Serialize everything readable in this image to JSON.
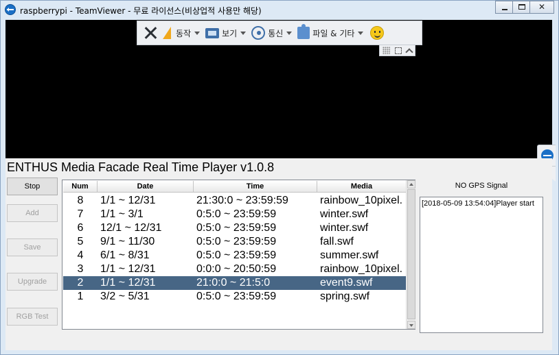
{
  "window": {
    "title": "raspberrypi - TeamViewer - 무료 라이선스(비상업적 사용만 해당)",
    "controls": {
      "minimize": "—",
      "maximize": "□",
      "close": "✕"
    }
  },
  "teamviewer_toolbar": {
    "items": [
      {
        "label": "동작",
        "icon": "bolt-icon"
      },
      {
        "label": "보기",
        "icon": "monitor-icon"
      },
      {
        "label": "통신",
        "icon": "phone-icon"
      },
      {
        "label": "파일 & 기타",
        "icon": "puzzle-icon"
      }
    ],
    "icons": [
      "close-icon",
      "smiley-icon",
      "grip-icon",
      "fullscreen-icon",
      "collapse-icon"
    ]
  },
  "app": {
    "title": "ENTHUS Media Facade Real Time Player v1.0.8",
    "buttons": [
      {
        "label": "Stop",
        "enabled": true
      },
      {
        "label": "Add",
        "enabled": false
      },
      {
        "label": "Save",
        "enabled": false
      },
      {
        "label": "Upgrade",
        "enabled": false
      },
      {
        "label": "RGB Test",
        "enabled": false
      }
    ],
    "table": {
      "columns": [
        "Num",
        "Date",
        "Time",
        "Media"
      ],
      "rows": [
        {
          "num": "8",
          "date": "1/1 ~ 12/31",
          "time": "21:30:0 ~ 23:59:59",
          "media": "rainbow_10pixel."
        },
        {
          "num": "7",
          "date": "1/1 ~ 3/1",
          "time": "0:5:0 ~ 23:59:59",
          "media": "winter.swf"
        },
        {
          "num": "6",
          "date": "12/1 ~ 12/31",
          "time": "0:5:0 ~ 23:59:59",
          "media": "winter.swf"
        },
        {
          "num": "5",
          "date": "9/1 ~ 11/30",
          "time": "0:5:0 ~ 23:59:59",
          "media": "fall.swf"
        },
        {
          "num": "4",
          "date": "6/1 ~ 8/31",
          "time": "0:5:0 ~ 23:59:59",
          "media": "summer.swf"
        },
        {
          "num": "3",
          "date": "1/1 ~ 12/31",
          "time": "0:0:0 ~ 20:50:59",
          "media": "rainbow_10pixel."
        },
        {
          "num": "2",
          "date": "1/1 ~ 12/31",
          "time": "21:0:0 ~ 21:5:0",
          "media": "event9.swf",
          "selected": true
        },
        {
          "num": "1",
          "date": "3/2 ~ 5/31",
          "time": "0:5:0 ~ 23:59:59",
          "media": "spring.swf"
        }
      ]
    },
    "gps_status": "NO GPS Signal",
    "log_text": "[2018-05-09 13:54:04]Player start"
  },
  "colors": {
    "selection": "#476685",
    "titlebar": "#dde9f5",
    "remote_background": "#000000"
  }
}
